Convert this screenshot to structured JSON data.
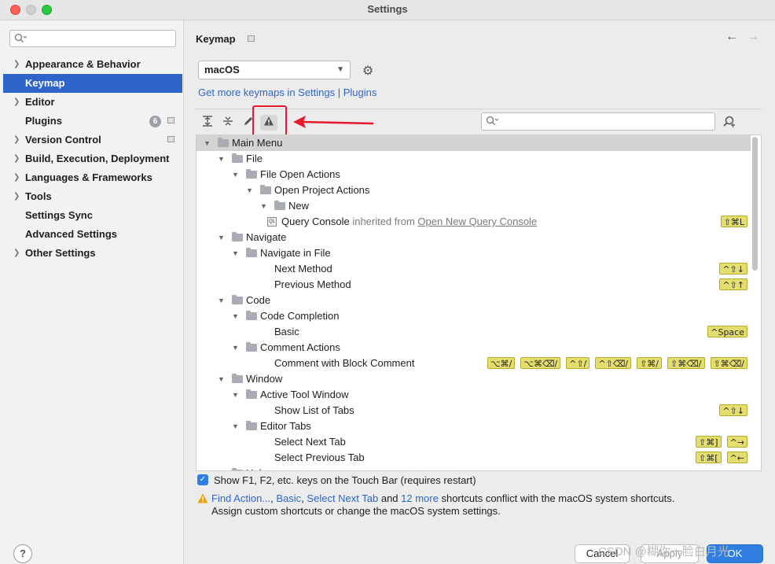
{
  "window": {
    "title": "Settings"
  },
  "sidebar": {
    "search_placeholder": "",
    "items": [
      {
        "label": "Appearance & Behavior",
        "expandable": true
      },
      {
        "label": "Keymap",
        "expandable": false,
        "selected": true
      },
      {
        "label": "Editor",
        "expandable": true
      },
      {
        "label": "Plugins",
        "expandable": false,
        "badge": "6"
      },
      {
        "label": "Version Control",
        "expandable": true
      },
      {
        "label": "Build, Execution, Deployment",
        "expandable": true
      },
      {
        "label": "Languages & Frameworks",
        "expandable": true
      },
      {
        "label": "Tools",
        "expandable": true
      },
      {
        "label": "Settings Sync",
        "expandable": false
      },
      {
        "label": "Advanced Settings",
        "expandable": false
      },
      {
        "label": "Other Settings",
        "expandable": true
      }
    ],
    "help_label": "?"
  },
  "header": {
    "breadcrumb": "Keymap",
    "back_icon": "arrow-left-icon",
    "forward_icon": "arrow-right-icon"
  },
  "keymap": {
    "selected": "macOS",
    "get_more_prefix": "Get more keymaps in Settings | ",
    "get_more_link": "Plugins"
  },
  "toolbar": {
    "icons": [
      "expand-all-icon",
      "collapse-all-icon",
      "edit-icon",
      "warning-icon"
    ],
    "search_placeholder": ""
  },
  "tree": {
    "rows": [
      {
        "label": "Main Menu",
        "level": 0,
        "expanded": true,
        "folder": true,
        "selected": true
      },
      {
        "label": "File",
        "level": 1,
        "expanded": true,
        "folder": true
      },
      {
        "label": "File Open Actions",
        "level": 2,
        "expanded": true,
        "folder": true
      },
      {
        "label": "Open Project Actions",
        "level": 3,
        "expanded": true,
        "folder": true
      },
      {
        "label": "New",
        "level": 4,
        "expanded": true,
        "folder": true
      },
      {
        "label": "Query Console",
        "level": 5,
        "action": true,
        "inherited": " inherited from ",
        "inherited_link": "Open New Query Console",
        "keys": [
          "⇧⌘L"
        ]
      },
      {
        "label": "Navigate",
        "level": 1,
        "expanded": true,
        "folder": true
      },
      {
        "label": "Navigate in File",
        "level": 2,
        "expanded": true,
        "folder": true
      },
      {
        "label": "Next Method",
        "level": 4,
        "keys": [
          "^⇧↓"
        ]
      },
      {
        "label": "Previous Method",
        "level": 4,
        "keys": [
          "^⇧↑"
        ]
      },
      {
        "label": "Code",
        "level": 1,
        "expanded": true,
        "folder": true
      },
      {
        "label": "Code Completion",
        "level": 2,
        "expanded": true,
        "folder": true
      },
      {
        "label": "Basic",
        "level": 4,
        "keys": [
          "^Space"
        ]
      },
      {
        "label": "Comment Actions",
        "level": 2,
        "expanded": true,
        "folder": true
      },
      {
        "label": "Comment with Block Comment",
        "level": 4,
        "keys": [
          "⌥⌘/",
          "⌥⌘⌫/",
          "^⇧/",
          "^⇧⌫/",
          "⇧⌘/",
          "⇧⌘⌫/",
          "⇧⌘⌫/"
        ]
      },
      {
        "label": "Window",
        "level": 1,
        "expanded": true,
        "folder": true
      },
      {
        "label": "Active Tool Window",
        "level": 2,
        "expanded": true,
        "folder": true
      },
      {
        "label": "Show List of Tabs",
        "level": 4,
        "keys": [
          "^⇧↓"
        ]
      },
      {
        "label": "Editor Tabs",
        "level": 2,
        "expanded": true,
        "folder": true
      },
      {
        "label": "Select Next Tab",
        "level": 4,
        "keys": [
          "⇧⌘]",
          "^→"
        ]
      },
      {
        "label": "Select Previous Tab",
        "level": 4,
        "keys": [
          "⇧⌘[",
          "^←"
        ]
      },
      {
        "label": "Help",
        "level": 1,
        "expanded": true,
        "folder": true
      }
    ]
  },
  "touchbar": {
    "checked": true,
    "label": "Show F1, F2, etc. keys on the Touch Bar (requires restart)"
  },
  "conflict": {
    "link1": "Find Action...",
    "sep1": ", ",
    "link2": "Basic",
    "sep2": ", ",
    "link3": "Select Next Tab",
    "sep3": " and ",
    "link4": "12 more",
    "tail": " shortcuts conflict with the macOS system shortcuts.",
    "line2": "Assign custom shortcuts or change the macOS system settings."
  },
  "buttons": {
    "cancel": "Cancel",
    "apply": "Apply",
    "ok": "OK"
  },
  "watermark": "CSDN @糊你一脸白月光",
  "colors": {
    "accent": "#2f65ca",
    "shortcut_bg": "#e4de6e",
    "annotation": "#e8192c"
  }
}
